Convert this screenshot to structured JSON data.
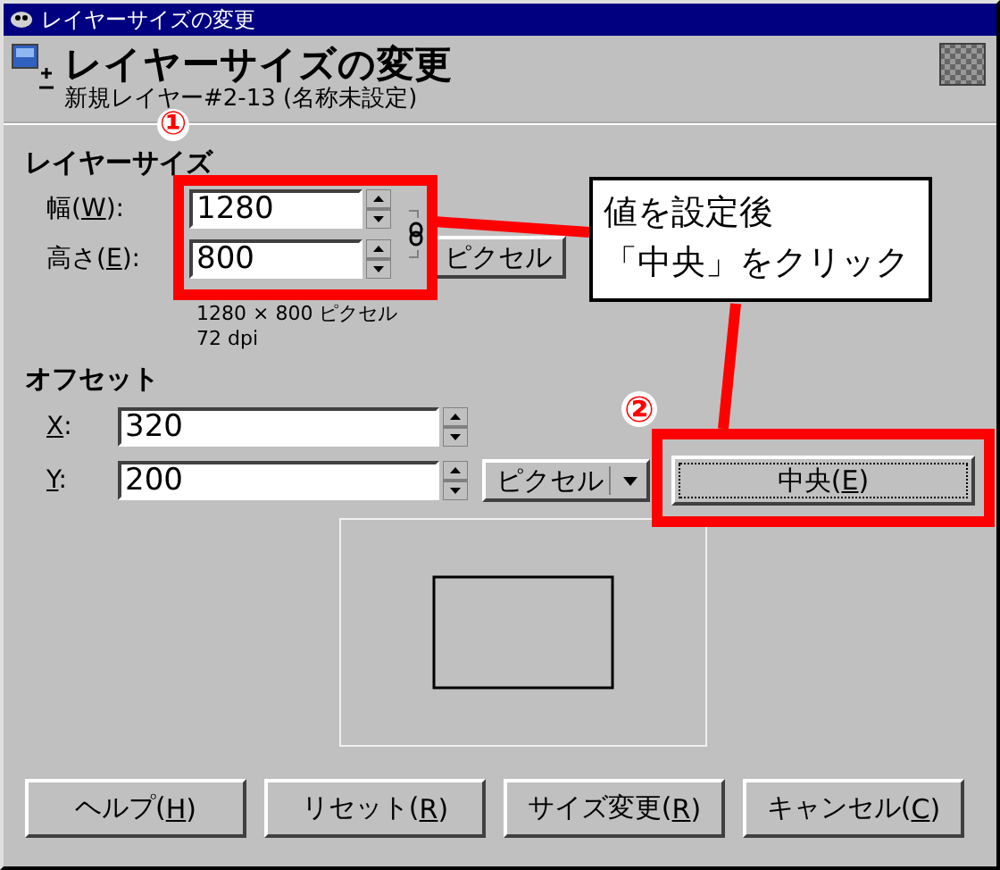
{
  "window": {
    "title": "レイヤーサイズの変更"
  },
  "header": {
    "title": "レイヤーサイズの変更",
    "subtitle": "新規レイヤー#2-13 (名称未設定)"
  },
  "layer_size": {
    "heading": "レイヤーサイズ",
    "fields": [
      {
        "label": "幅(W):",
        "value": "1280"
      },
      {
        "label": "高さ(E):",
        "value": "800"
      }
    ],
    "chain": {
      "linked": true
    },
    "unit": "ピクセル",
    "info": [
      "1280 × 800 ピクセル",
      "72 dpi"
    ]
  },
  "offset": {
    "heading": "オフセット",
    "fields": [
      {
        "label": "X:",
        "value": "320"
      },
      {
        "label": "Y:",
        "value": "200"
      }
    ],
    "unit": "ピクセル",
    "center_button": "中央(E)"
  },
  "buttons": [
    "ヘルプ(H)",
    "リセット(R)",
    "サイズ変更(R)",
    "キャンセル(C)"
  ],
  "annotations": {
    "markers": [
      "①",
      "②"
    ],
    "callout": [
      "値を設定後",
      "「中央」をクリック"
    ]
  }
}
